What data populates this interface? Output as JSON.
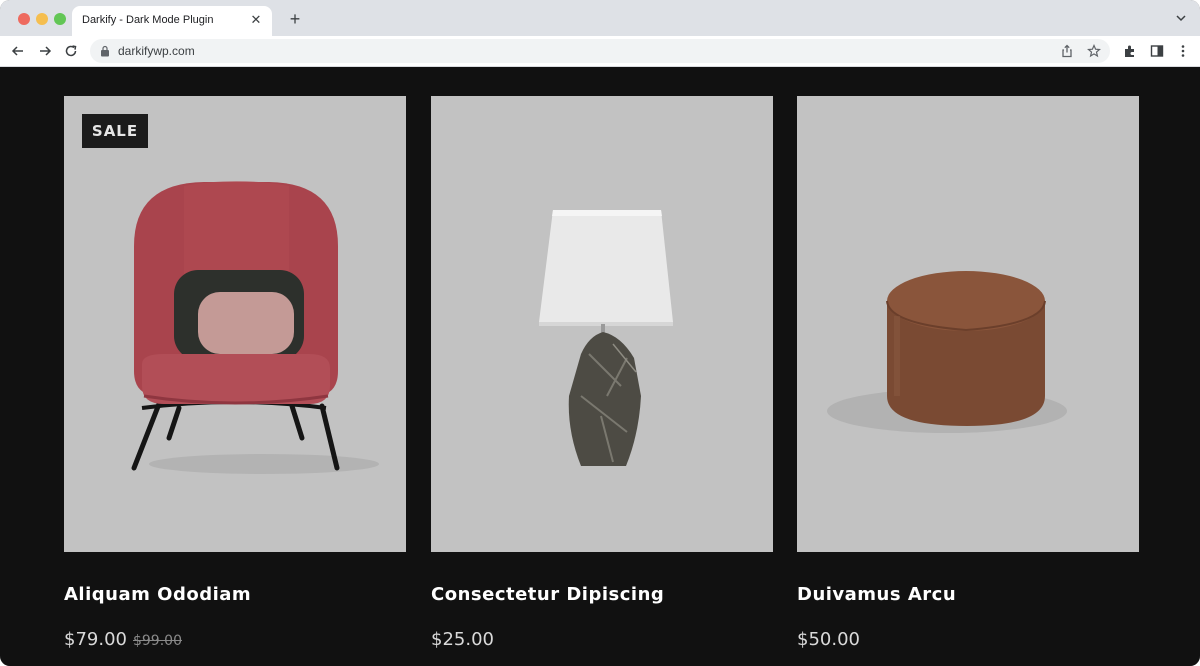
{
  "browser": {
    "tab_title": "Darkify - Dark Mode Plugin",
    "url": "darkifywp.com",
    "icons": [
      "close-icon",
      "plus-icon",
      "chevron-down-icon",
      "back-arrow-icon",
      "forward-arrow-icon",
      "reload-icon",
      "lock-icon",
      "share-icon",
      "star-icon",
      "extensions-icon",
      "side-panel-icon",
      "more-menu-icon"
    ]
  },
  "products": [
    {
      "title": "Aliquam Ododiam",
      "price": "$79.00",
      "old_price": "$99.00",
      "badge": "SALE",
      "image": "red-armchair"
    },
    {
      "title": "Consectetur Dipiscing",
      "price": "$25.00",
      "image": "marble-table-lamp"
    },
    {
      "title": "Duivamus Arcu",
      "price": "$50.00",
      "image": "brown-pouf"
    }
  ],
  "colors": {
    "page_bg": "#111111",
    "card_bg": "#c2c2c2",
    "chair": "#a9444d",
    "pouf": "#7a4a33"
  }
}
